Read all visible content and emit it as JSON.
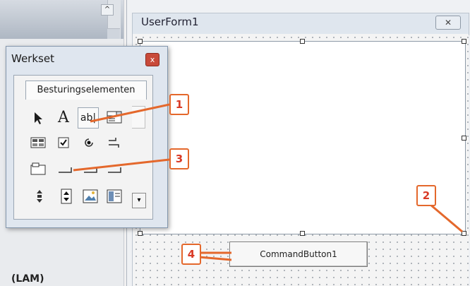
{
  "project_pane": {
    "scroll_up_glyph": "^",
    "bottom_label": "(LAM)"
  },
  "userform": {
    "title": "UserForm1",
    "close_glyph": "✕",
    "command_button_label": "CommandButton1"
  },
  "werkset": {
    "title": "Werkset",
    "close_glyph": "x",
    "tab_label": "Besturingselementen",
    "tools_row1": [
      {
        "name": "select-objects",
        "glyph": "◤"
      },
      {
        "name": "label",
        "glyph": "A"
      },
      {
        "name": "textbox",
        "glyph": "ab|"
      },
      {
        "name": "combobox",
        "glyph": "☷"
      }
    ],
    "scroll_down_glyph": "▾"
  },
  "callouts": [
    "1",
    "2",
    "3",
    "4"
  ],
  "colors": {
    "callout_border": "#e4682c",
    "callout_text": "#d93a26",
    "arrow": "#e4682c"
  }
}
